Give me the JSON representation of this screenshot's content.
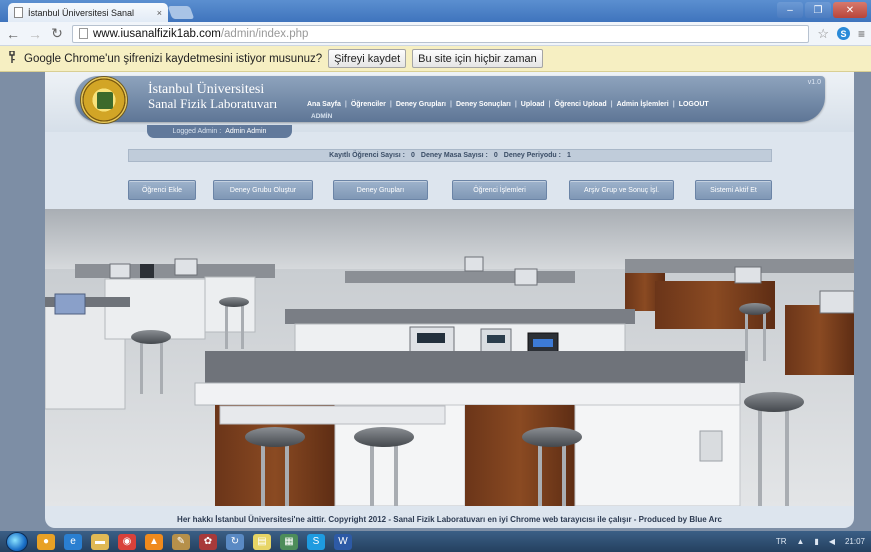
{
  "browser": {
    "tab_title": "İstanbul Üniversitesi Sanal",
    "tab_close": "×",
    "url_host": "www.iusanalfizik1ab.com",
    "url_path": "/admin/index.php",
    "password_prompt": "Google Chrome'un şifrenizi kaydetmesini istiyor musunuz?",
    "save_password_label": "Şifreyi kaydet",
    "never_label": "Bu site için hiçbir zaman"
  },
  "site": {
    "name_line1": "İstanbul Üniversitesi",
    "name_line2": "Sanal Fizik Laboratuvarı",
    "version": "v1.0",
    "nav": [
      "Ana Sayfa",
      "Öğrenciler",
      "Deney Grupları",
      "Deney Sonuçları",
      "Upload",
      "Öğrenci Upload",
      "Admin İşlemleri",
      "LOGOUT"
    ],
    "nav_admin_label": "ADMİN",
    "logged_label": "Logged Admin :",
    "logged_name": "Admin Admin",
    "stats": {
      "students_label": "Kayıtlı Öğrenci Sayısı :",
      "students_value": "0",
      "tables_label": "Deney Masa Sayısı :",
      "tables_value": "0",
      "period_label": "Deney Periyodu :",
      "period_value": "1"
    },
    "actions": [
      "Öğrenci Ekle",
      "Deney Grubu Oluştur",
      "Deney Grupları",
      "Öğrenci İşlemleri",
      "Arşiv Grup ve Sonuç İşl.",
      "Sistemi Aktif Et"
    ],
    "footer": "Her hakkı İstanbul Üniversitesi'ne aittir. Copyright 2012 - Sanal Fizik Laboratuvarı en iyi Chrome web tarayıcısı ile çalışır - Produced by Blue Arc"
  },
  "taskbar": {
    "lang": "TR",
    "time": "21:07"
  },
  "colors": {
    "header_band": "#6f87a6",
    "button": "#8da4c1",
    "password_bar": "#f6efc2",
    "taskbar": "#2e4c70"
  }
}
